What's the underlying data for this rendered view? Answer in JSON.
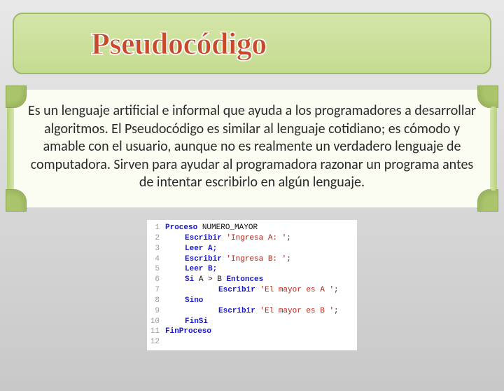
{
  "title": "Pseudocódigo",
  "description": "Es un lenguaje artificial e informal que ayuda a los programadores a desarrollar algoritmos. El Pseudocódigo es similar al lenguaje cotidiano; es cómodo y amable con el usuario, aunque no es realmente un verdadero lenguaje de computadora. Sirven para ayudar al programadora razonar un programa antes de intentar escribirlo en algún lenguaje.",
  "code": {
    "lines": [
      "1",
      "2",
      "3",
      "4",
      "5",
      "6",
      "7",
      "8",
      "9",
      "10",
      "11",
      "12"
    ],
    "kw_proceso": "Proceso",
    "proc_name": "NUMERO_MAYOR",
    "kw_escribir": "Escribir",
    "kw_leer": "Leer",
    "kw_si": "Si",
    "kw_entonces": "Entonces",
    "kw_sino": "Sino",
    "kw_finsi": "FinSi",
    "kw_finproceso": "FinProceso",
    "str_ingresa_a": "'Ingresa A: '",
    "str_ingresa_b": "'Ingresa B: '",
    "str_mayor_a": "'El mayor es A '",
    "str_mayor_b": "'El mayor es B '",
    "leer_a": "Leer A;",
    "leer_b": "Leer B;",
    "cond": "A > B",
    "semi": ";"
  }
}
